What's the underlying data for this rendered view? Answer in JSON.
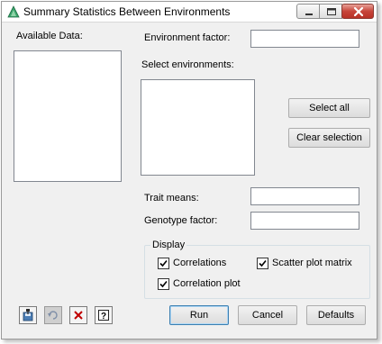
{
  "window": {
    "title": "Summary Statistics Between Environments"
  },
  "titlebar_icons": [
    "genstat-app-icon",
    "minimize-icon",
    "maximize-icon",
    "close-icon"
  ],
  "available_data": {
    "label": "Available Data:"
  },
  "environment_factor": {
    "label": "Environment factor:",
    "value": ""
  },
  "select_environments": {
    "label": "Select environments:",
    "items": []
  },
  "buttons": {
    "select_all": "Select all",
    "clear_selection": "Clear selection",
    "run": "Run",
    "cancel": "Cancel",
    "defaults": "Defaults"
  },
  "trait_means": {
    "label": "Trait means:",
    "value": ""
  },
  "genotype_factor": {
    "label": "Genotype factor:",
    "value": ""
  },
  "display": {
    "title": "Display",
    "correlations": {
      "label": "Correlations",
      "checked": true
    },
    "scatter_plot_matrix": {
      "label": "Scatter plot matrix",
      "checked": true
    },
    "correlation_plot": {
      "label": "Correlation plot",
      "checked": true
    }
  },
  "toolbar_icons": [
    "save-options-icon",
    "undo-icon",
    "clear-icon",
    "help-icon"
  ],
  "colors": {
    "close_button": "#c7453a",
    "accent_border": "#3c7fb1",
    "clear_x": "#c00000"
  }
}
